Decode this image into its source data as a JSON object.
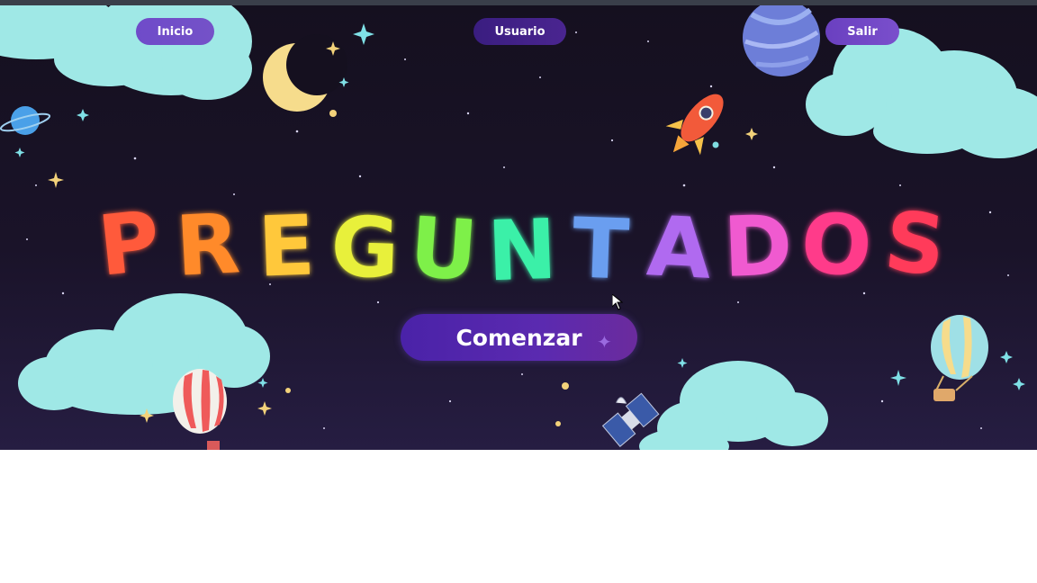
{
  "nav": {
    "inicio": "Inicio",
    "usuario": "Usuario",
    "salir": "Salir"
  },
  "hero": {
    "title": "PREGUNTADOS",
    "letter_colors": [
      "#ff5a3a",
      "#ff8a2a",
      "#ffc83a",
      "#e8f03a",
      "#7ef04a",
      "#3af0a8",
      "#6a9ef0",
      "#b06af0",
      "#f05ad0",
      "#ff3a8a",
      "#ff3a5a"
    ],
    "cta_label": "Comenzar"
  },
  "colors": {
    "sky": "#15101f",
    "cloud": "#9fe8e6",
    "nav_button": "#6f4bc9",
    "cta": "#4a22a8"
  },
  "icons": [
    "moon-icon",
    "planet-icon",
    "rocket-icon",
    "hot-air-balloon-icon",
    "satellite-icon",
    "sparkle-icon",
    "cursor-icon"
  ]
}
